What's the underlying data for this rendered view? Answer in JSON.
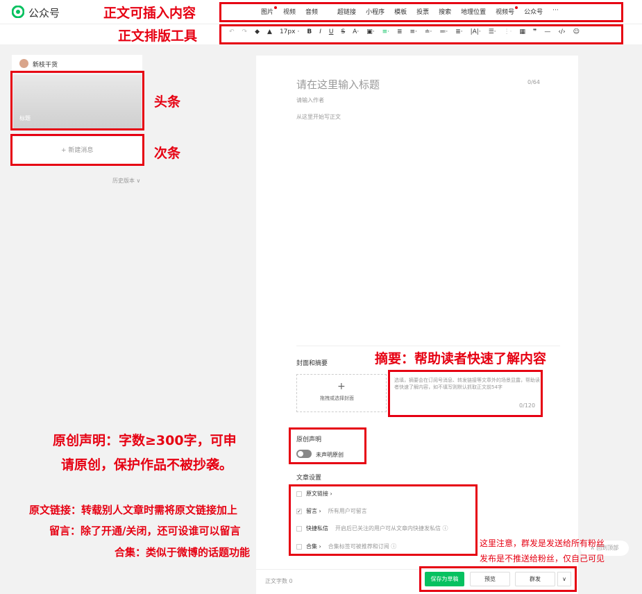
{
  "app": {
    "title": "公众号"
  },
  "annotations": {
    "insert": "正文可插入内容",
    "format": "正文排版工具",
    "headline": "头条",
    "secondary": "次条",
    "abstract": "摘要：帮助读者快速了解内容",
    "original_l1": "原创声明：字数≥300字，可申",
    "original_l2": "请原创，保护作品不被抄袭。",
    "link_note": "原文链接：转载别人文章时需将原文链接加上",
    "comment_note": "留言：除了开通/关闭，还可设谁可以留言",
    "collection_note": "合集：类似于微博的话题功能",
    "publish_l1": "这里注意，群发是发送给所有粉丝",
    "publish_l2": "发布是不推送给粉丝，仅自己可见"
  },
  "insert_toolbar": {
    "items": [
      "图片",
      "视频",
      "音频",
      "超链接",
      "小程序",
      "模板",
      "投票",
      "搜索",
      "地理位置",
      "视频号",
      "公众号",
      "···"
    ]
  },
  "format_toolbar": {
    "font_size": "17px"
  },
  "sidebar": {
    "account_name": "新枝干货",
    "headline_label": "标题",
    "new_message": "+ 新建消息",
    "history": "历史版本"
  },
  "editor": {
    "title_placeholder": "请在这里输入标题",
    "title_count": "0/64",
    "author_placeholder": "请输入作者",
    "body_placeholder": "从这里开始写正文",
    "cover_section": "封面和摘要",
    "cover_plus": "+",
    "cover_hint": "拖拽或选择封面",
    "abstract_placeholder": "选填，摘要会在订阅号消息、转发链接等文章外的场景显露，帮助读者快速了解内容，如不填写则默认抓取正文前54字",
    "abstract_count": "0/120",
    "original_section": "原创声明",
    "original_toggle": "未声明原创",
    "settings_section": "文章设置",
    "settings": [
      {
        "label": "原文链接 ›",
        "desc": "",
        "checked": false
      },
      {
        "label": "留言 ›",
        "desc": "所有用户可留言",
        "checked": true
      },
      {
        "label": "快捷私信",
        "desc": "开启后已关注的用户可从文章内快捷发私信 ⓘ",
        "checked": false
      },
      {
        "label": "合集 ›",
        "desc": "合集标签可被推荐和订阅 ⓘ",
        "checked": false
      }
    ]
  },
  "bottom": {
    "word_count": "正文字数 0",
    "save": "保存为草稿",
    "preview": "预览",
    "publish": "群发",
    "more": "∨",
    "back_top": "∧ 回到顶部"
  },
  "colors": {
    "accent": "#07c160",
    "annotation": "#e60012"
  }
}
